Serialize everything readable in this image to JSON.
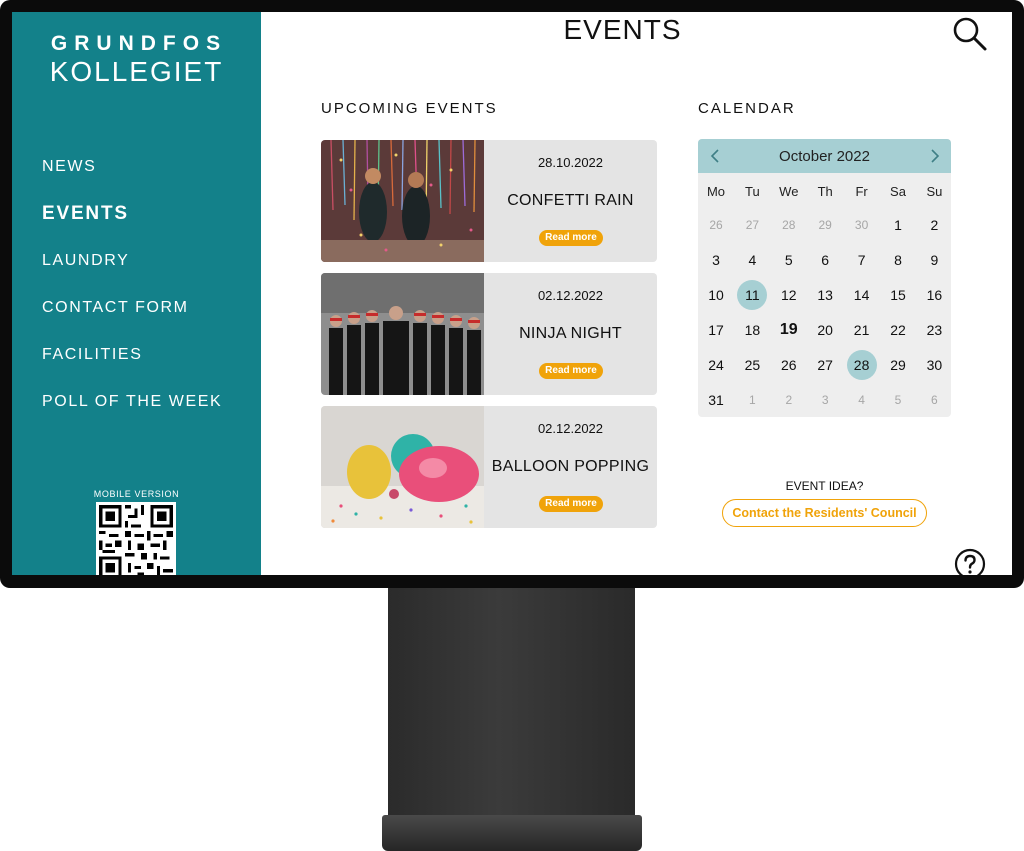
{
  "sidebar": {
    "brand_top": "GRUNDFOS",
    "brand_bottom": "KOLLEGIET",
    "nav": [
      {
        "label": "NEWS",
        "active": false
      },
      {
        "label": "EVENTS",
        "active": true
      },
      {
        "label": "LAUNDRY",
        "active": false
      },
      {
        "label": "CONTACT FORM",
        "active": false
      },
      {
        "label": "FACILITIES",
        "active": false
      },
      {
        "label": "POLL OF THE WEEK",
        "active": false
      }
    ],
    "mobile_label": "MOBILE VERSION"
  },
  "header": {
    "title": "EVENTS",
    "search_icon": "search-icon"
  },
  "upcoming": {
    "title": "UPCOMING EVENTS",
    "events": [
      {
        "date": "28.10.2022",
        "title": "CONFETTI RAIN",
        "button": "Read more"
      },
      {
        "date": "02.12.2022",
        "title": "NINJA NIGHT",
        "button": "Read more"
      },
      {
        "date": "02.12.2022",
        "title": "BALLOON POPPING",
        "button": "Read more"
      }
    ]
  },
  "calendar": {
    "title": "CALENDAR",
    "month": "October 2022",
    "weekdays": [
      "Mo",
      "Tu",
      "We",
      "Th",
      "Fr",
      "Sa",
      "Su"
    ],
    "weeks": [
      [
        "26",
        "27",
        "28",
        "29",
        "30",
        "1",
        "2"
      ],
      [
        "3",
        "4",
        "5",
        "6",
        "7",
        "8",
        "9"
      ],
      [
        "10",
        "11",
        "12",
        "13",
        "14",
        "15",
        "16"
      ],
      [
        "17",
        "18",
        "19",
        "20",
        "21",
        "22",
        "23"
      ],
      [
        "24",
        "25",
        "26",
        "27",
        "28",
        "29",
        "30"
      ],
      [
        "31",
        "1",
        "2",
        "3",
        "4",
        "5",
        "6"
      ]
    ],
    "today": "19",
    "highlighted": [
      "11",
      "28"
    ]
  },
  "idea": {
    "label": "EVENT IDEA?",
    "button": "Contact the Residents' Council"
  },
  "colors": {
    "sidebar": "#13818a",
    "accent": "#f0a30a",
    "calendar_header": "#a6cfd3",
    "card": "#e4e4e4"
  }
}
